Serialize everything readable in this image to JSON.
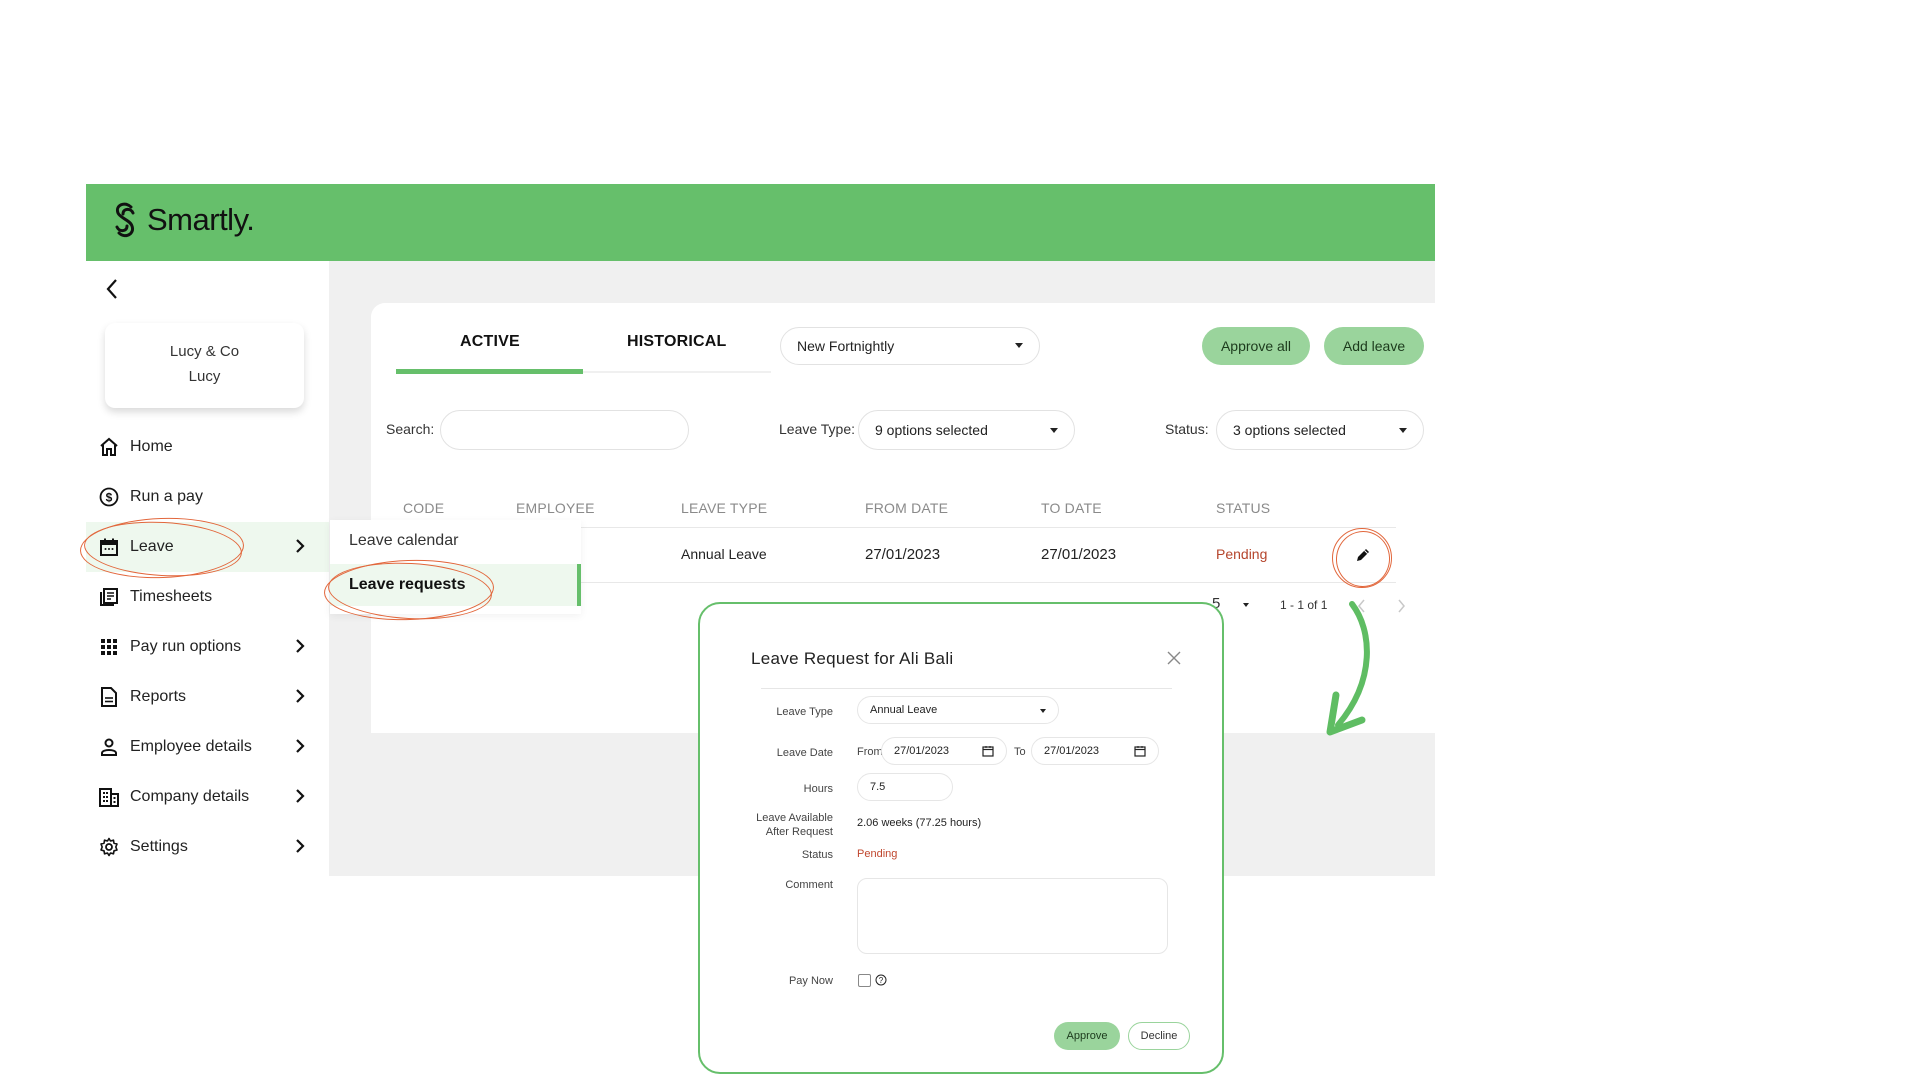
{
  "app": {
    "brand": "Smartly."
  },
  "sidebar": {
    "company": {
      "name": "Lucy & Co",
      "user": "Lucy"
    },
    "items": [
      {
        "label": "Home",
        "icon": "home-icon",
        "has_chevron": false
      },
      {
        "label": "Run a pay",
        "icon": "dollar-circle-icon",
        "has_chevron": false
      },
      {
        "label": "Leave",
        "icon": "calendar-icon",
        "has_chevron": true,
        "active": true
      },
      {
        "label": "Timesheets",
        "icon": "timesheets-icon",
        "has_chevron": false
      },
      {
        "label": "Pay run options",
        "icon": "grid-icon",
        "has_chevron": true
      },
      {
        "label": "Reports",
        "icon": "document-icon",
        "has_chevron": true
      },
      {
        "label": "Employee details",
        "icon": "person-icon",
        "has_chevron": true
      },
      {
        "label": "Company details",
        "icon": "building-icon",
        "has_chevron": true
      },
      {
        "label": "Settings",
        "icon": "gear-icon",
        "has_chevron": true
      }
    ],
    "leave_submenu": [
      {
        "label": "Leave calendar",
        "active": false
      },
      {
        "label": "Leave requests",
        "active": true
      }
    ]
  },
  "main": {
    "tabs": [
      {
        "label": "ACTIVE",
        "active": true
      },
      {
        "label": "HISTORICAL",
        "active": false
      }
    ],
    "pay_schedule_select": {
      "value": "New Fortnightly"
    },
    "buttons": {
      "approve_all": "Approve all",
      "add_leave": "Add leave"
    },
    "filters": {
      "search_label": "Search:",
      "search_value": "",
      "leave_type_label": "Leave Type:",
      "leave_type_value": "9 options selected",
      "status_label": "Status:",
      "status_value": "3 options selected"
    },
    "table": {
      "columns": [
        "CODE",
        "EMPLOYEE",
        "LEAVE TYPE",
        "FROM DATE",
        "TO DATE",
        "STATUS"
      ],
      "rows": [
        {
          "code": "",
          "employee": "",
          "leave_type": "Annual Leave",
          "from_date": "27/01/2023",
          "to_date": "27/01/2023",
          "status": "Pending"
        }
      ]
    },
    "pagination": {
      "rows_per_page": "5",
      "range": "1 - 1 of 1"
    }
  },
  "modal": {
    "title": "Leave Request for Ali Bali",
    "fields": {
      "leave_type_label": "Leave Type",
      "leave_type_value": "Annual Leave",
      "leave_date_label": "Leave Date",
      "from_label": "From",
      "from_value": "27/01/2023",
      "to_label": "To",
      "to_value": "27/01/2023",
      "hours_label": "Hours",
      "hours_value": "7.5",
      "available_label_line1": "Leave Available",
      "available_label_line2": "After Request",
      "available_value": "2.06 weeks (77.25 hours)",
      "status_label": "Status",
      "status_value": "Pending",
      "comment_label": "Comment",
      "comment_value": "",
      "pay_now_label": "Pay Now",
      "pay_now_checked": false
    },
    "buttons": {
      "approve": "Approve",
      "decline": "Decline"
    }
  },
  "colors": {
    "brand_green": "#66bf6b",
    "button_green": "#9ad49c",
    "pending": "#b5452c",
    "annotation": "#e2673c"
  }
}
